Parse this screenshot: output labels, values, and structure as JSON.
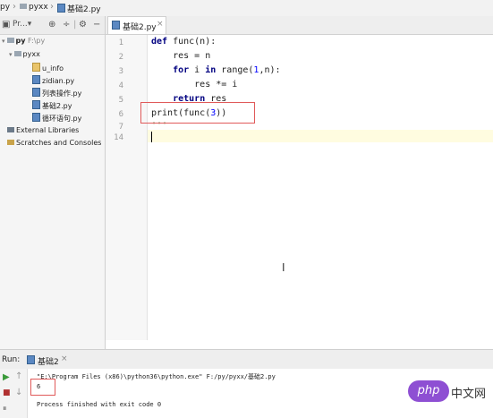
{
  "breadcrumb": {
    "items": [
      "py",
      "pyxx",
      "基础2.py"
    ]
  },
  "project": {
    "toolbar_label": "Pr...▾",
    "items": [
      {
        "label": "py",
        "suffix": "F:\\py"
      },
      {
        "label": "pyxx"
      },
      {
        "label": "u_info"
      },
      {
        "label": "zidian.py"
      },
      {
        "label": "列表操作.py"
      },
      {
        "label": "基础2.py"
      },
      {
        "label": "循环语句.py"
      },
      {
        "label": "External Libraries"
      },
      {
        "label": "Scratches and Consoles"
      }
    ]
  },
  "editor": {
    "tab_label": "基础2.py",
    "line_numbers": [
      "1",
      "2",
      "3",
      "4",
      "5",
      "6",
      "7",
      "14"
    ],
    "code": {
      "l1_kw": "def",
      "l1_rest": " func(n):",
      "l2": "    res = n",
      "l3_kw1": "for",
      "l3_mid": " i ",
      "l3_kw2": "in",
      "l3_rest1": " range(",
      "l3_n1": "1",
      "l3_rest2": ",n):",
      "l4": "        res *= i",
      "l5_kw": "return",
      "l5_rest": " res",
      "l6_a": "print(func(",
      "l6_n": "3",
      "l6_b": "))",
      "l7": "'''"
    }
  },
  "run": {
    "label": "Run:",
    "tab_label": "基础2",
    "command": "\"E:\\Program Files (x86)\\python36\\python.exe\" F:/py/pyxx/基础2.py",
    "output": "6",
    "exit_message": "Process finished with exit code 0"
  },
  "watermark": {
    "badge": "php",
    "text": "中文网"
  }
}
